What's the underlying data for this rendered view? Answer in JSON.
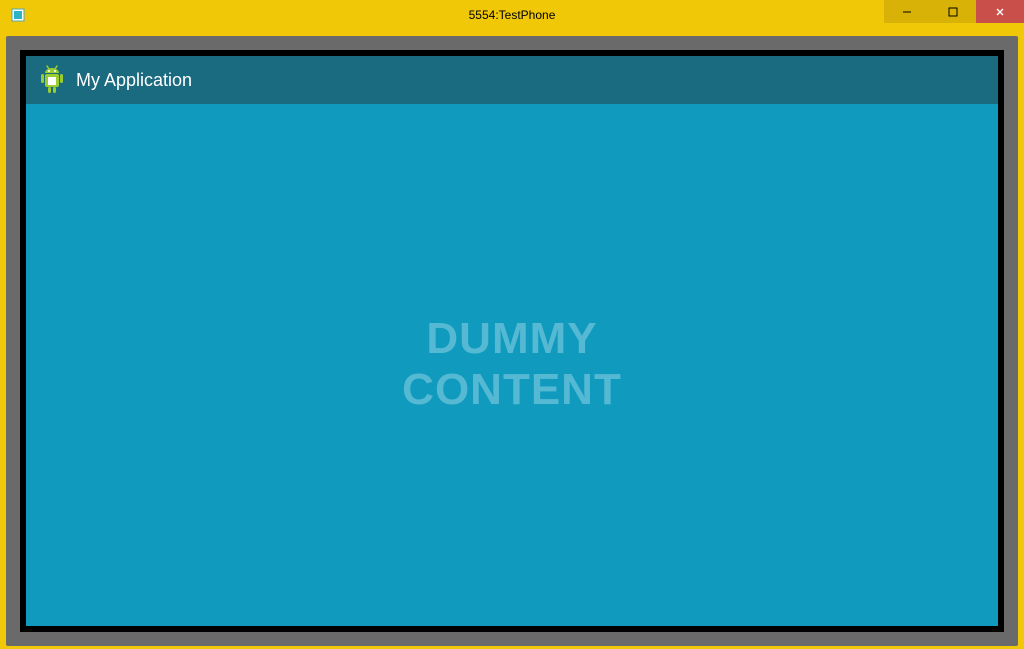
{
  "window": {
    "title": "5554:TestPhone"
  },
  "app": {
    "title": "My Application",
    "content_line1": "DUMMY",
    "content_line2": "CONTENT"
  },
  "controls": {
    "minimize": "–",
    "maximize": "□",
    "close": "✕"
  }
}
